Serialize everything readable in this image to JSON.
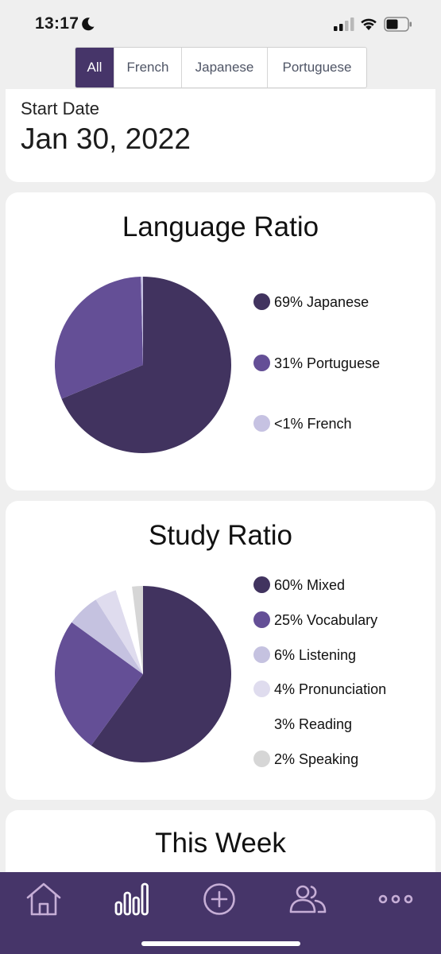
{
  "status_bar": {
    "time": "13:17"
  },
  "filter_tabs": [
    {
      "label": "All",
      "active": true
    },
    {
      "label": "French",
      "active": false
    },
    {
      "label": "Japanese",
      "active": false
    },
    {
      "label": "Portuguese",
      "active": false
    }
  ],
  "start_card": {
    "label": "Start Date",
    "value": "Jan 30, 2022"
  },
  "language_card": {
    "title": "Language Ratio"
  },
  "study_card": {
    "title": "Study Ratio"
  },
  "week_card": {
    "title": "This Week"
  },
  "chart_data": [
    {
      "type": "pie",
      "title": "Language Ratio",
      "slices": [
        {
          "label": "69% Japanese",
          "value": 69,
          "color": "#41335f"
        },
        {
          "label": "31% Portuguese",
          "value": 31,
          "color": "#644f96"
        },
        {
          "label": "<1% French",
          "value": 0.4,
          "color": "#c6c2e2"
        }
      ],
      "legend_position": "right"
    },
    {
      "type": "pie",
      "title": "Study Ratio",
      "slices": [
        {
          "label": "60% Mixed",
          "value": 60,
          "color": "#41335f"
        },
        {
          "label": "25% Vocabulary",
          "value": 25,
          "color": "#644f96"
        },
        {
          "label": "6% Listening",
          "value": 6,
          "color": "#c5c2e0"
        },
        {
          "label": "4% Pronunciation",
          "value": 4,
          "color": "#dfdcee"
        },
        {
          "label": "3% Reading",
          "value": 3,
          "color": "#ffffff"
        },
        {
          "label": "2% Speaking",
          "value": 2,
          "color": "#d6d6d6"
        }
      ],
      "legend_position": "right"
    }
  ],
  "tab_bar": {
    "tabs": [
      {
        "icon": "home-icon",
        "active": false
      },
      {
        "icon": "stats-icon",
        "active": true
      },
      {
        "icon": "add-icon",
        "active": false
      },
      {
        "icon": "people-icon",
        "active": false
      },
      {
        "icon": "more-icon",
        "active": false
      }
    ],
    "colors": {
      "background": "#463569",
      "inactive_icon": "#c6aed6",
      "active_icon": "#ffffff"
    }
  }
}
